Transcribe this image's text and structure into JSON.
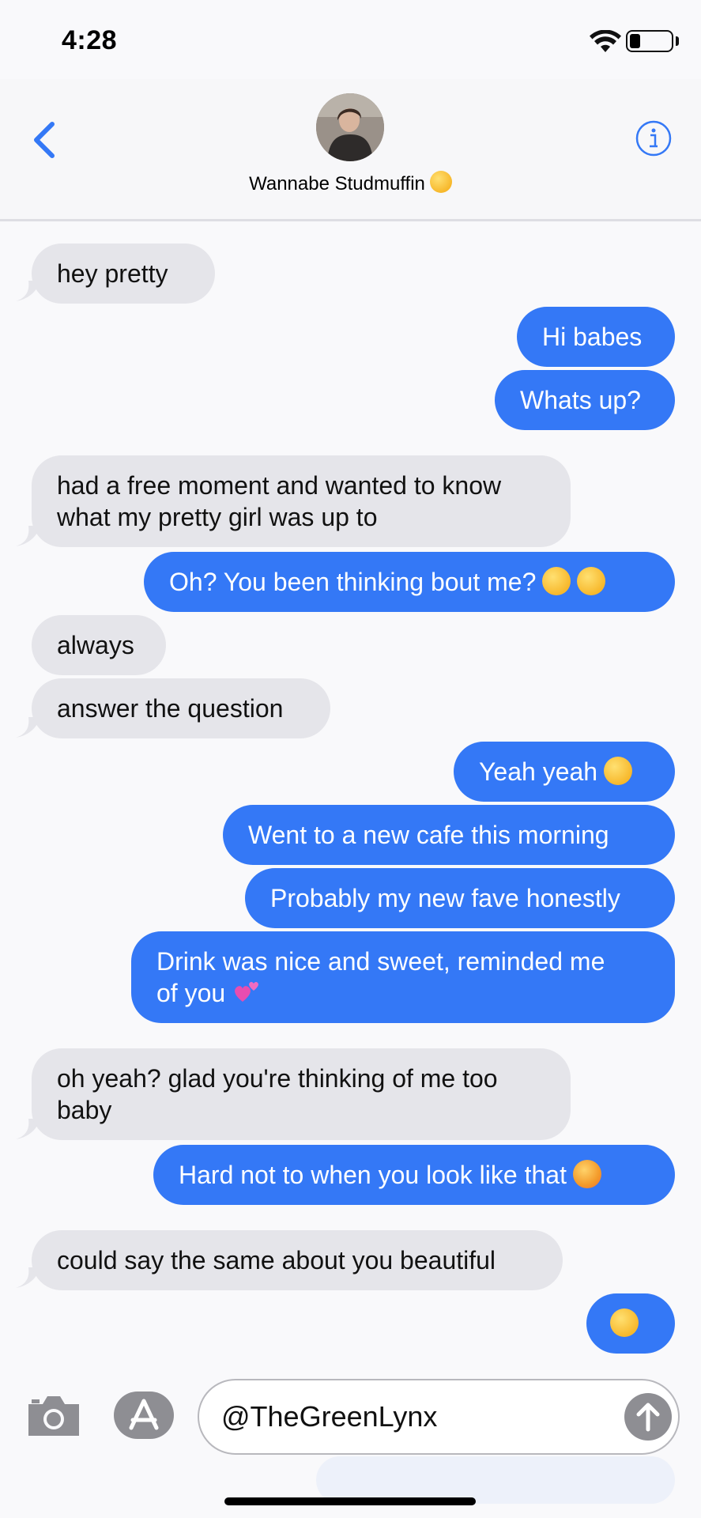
{
  "status_bar": {
    "time": "4:28"
  },
  "header": {
    "contact_name": "Wannabe Studmuffin",
    "contact_emoji": "face-with-hand-over-mouth"
  },
  "messages": [
    {
      "direction": "in",
      "text": "hey pretty"
    },
    {
      "direction": "out",
      "text": "Hi babes"
    },
    {
      "direction": "out",
      "text": "Whats up?"
    },
    {
      "direction": "in",
      "lines": [
        "had a free moment and wanted to know",
        "what my pretty girl was up to"
      ]
    },
    {
      "direction": "out",
      "text": "Oh? You been thinking bout me?",
      "emojis": [
        "face-with-monocle",
        "winking-face"
      ]
    },
    {
      "direction": "in",
      "text": "always"
    },
    {
      "direction": "in",
      "text": "answer the question"
    },
    {
      "direction": "out",
      "text": "Yeah yeah",
      "emojis": [
        "unamused-face"
      ]
    },
    {
      "direction": "out",
      "text": "Went to a new cafe this morning"
    },
    {
      "direction": "out",
      "text": "Probably my new fave honestly"
    },
    {
      "direction": "out",
      "lines": [
        "Drink was nice and sweet, reminded me",
        "of you"
      ],
      "emojis": [
        "two-hearts"
      ]
    },
    {
      "direction": "in",
      "lines": [
        "oh yeah? glad you're thinking of me too",
        "baby"
      ]
    },
    {
      "direction": "out",
      "text": "Hard not to when you look like that",
      "emojis": [
        "hot-face"
      ]
    },
    {
      "direction": "in",
      "text": "could say the same about you beautiful"
    },
    {
      "direction": "out",
      "text": "",
      "emojis": [
        "kissing-face-with-closed-eyes"
      ]
    }
  ],
  "compose": {
    "value": "@TheGreenLynx"
  },
  "icons": {
    "back": "chevron-left-icon",
    "info": "info-icon",
    "camera": "camera-icon",
    "apps": "app-store-icon",
    "send": "send-arrow-icon"
  },
  "colors": {
    "accent": "#3478f6",
    "incoming_bubble": "#e5e5ea",
    "background": "#f9f9fb"
  }
}
